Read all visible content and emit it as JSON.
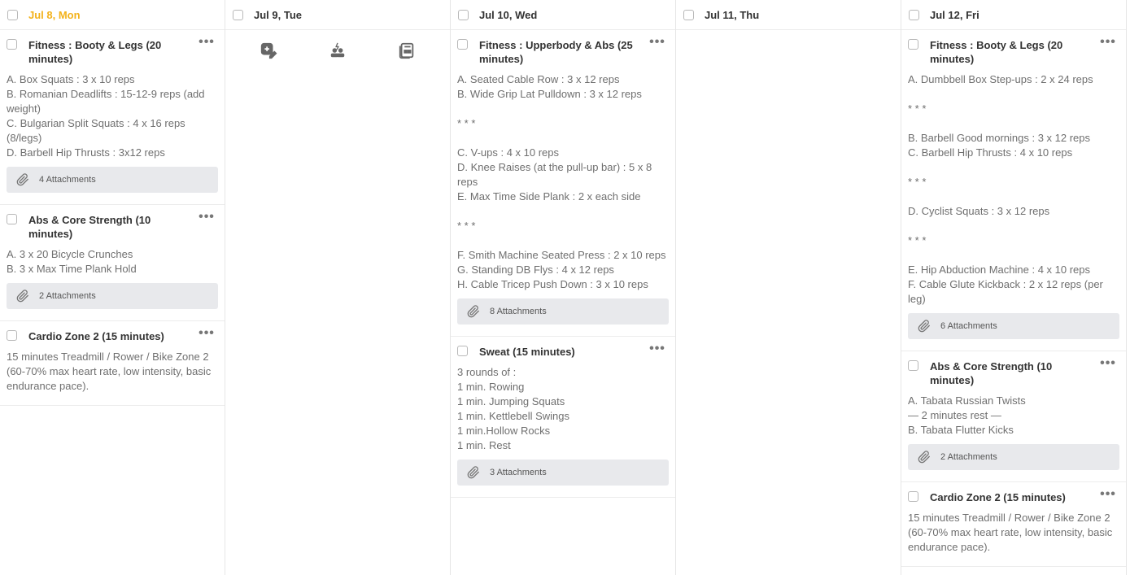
{
  "columns": [
    {
      "title": "Jul 8, Mon",
      "today": true,
      "cards": [
        {
          "title": "Fitness : Booty & Legs (20 minutes)",
          "lines": [
            "A. Box Squats : 3 x 10 reps",
            "B. Romanian Deadlifts : 15-12-9 reps (add weight)",
            "C. Bulgarian Split Squats : 4 x 16 reps (8/legs)",
            "D. Barbell Hip Thrusts : 3x12 reps"
          ],
          "attachments": "4 Attachments"
        },
        {
          "title": "Abs & Core Strength (10 minutes)",
          "lines": [
            "A. 3 x 20 Bicycle Crunches",
            "B. 3 x Max Time Plank Hold"
          ],
          "attachments": "2 Attachments"
        },
        {
          "title": "Cardio Zone 2 (15 minutes)",
          "lines": [
            "15 minutes Treadmill / Rower / Bike Zone 2 (60-70% max heart rate, low intensity, basic endurance pace)."
          ],
          "attachments": null
        }
      ]
    },
    {
      "title": "Jul 9, Tue",
      "today": false,
      "tools": [
        "add-card-icon",
        "template-icon",
        "board-icon"
      ],
      "cards": []
    },
    {
      "title": "Jul 10, Wed",
      "today": false,
      "cards": [
        {
          "title": "Fitness : Upperbody & Abs (25 minutes)",
          "lines": [
            "A. Seated Cable Row : 3 x 12 reps",
            "B. Wide Grip Lat Pulldown : 3 x 12 reps",
            "",
            "* * *",
            "",
            "C. V-ups : 4 x 10 reps",
            "D. Knee Raises (at the pull-up bar) : 5 x 8 reps",
            "E. Max Time Side Plank : 2 x each side",
            "",
            "* * *",
            "",
            "F. Smith Machine Seated Press : 2 x 10 reps",
            "G. Standing DB Flys : 4 x 12 reps",
            "H. Cable Tricep Push Down : 3 x 10 reps"
          ],
          "attachments": "8 Attachments"
        },
        {
          "title": "Sweat (15 minutes)",
          "lines": [
            "3 rounds of :",
            "1 min. Rowing",
            "1 min. Jumping Squats",
            "1 min. Kettlebell Swings",
            "1 min.Hollow Rocks",
            "1 min. Rest"
          ],
          "attachments": "3 Attachments"
        }
      ]
    },
    {
      "title": "Jul 11, Thu",
      "today": false,
      "cards": []
    },
    {
      "title": "Jul 12, Fri",
      "today": false,
      "cards": [
        {
          "title": "Fitness : Booty & Legs (20 minutes)",
          "lines": [
            "A. Dumbbell Box Step-ups : 2 x 24 reps",
            "",
            "* * *",
            "",
            "B. Barbell Good mornings : 3 x 12 reps",
            "C. Barbell Hip Thrusts : 4 x 10 reps",
            "",
            "* * *",
            "",
            "D. Cyclist Squats : 3 x 12 reps",
            "",
            "* * *",
            "",
            "E. Hip Abduction Machine : 4 x 10 reps",
            "F. Cable Glute Kickback : 2 x 12 reps (per leg)"
          ],
          "attachments": "6 Attachments"
        },
        {
          "title": "Abs & Core Strength (10 minutes)",
          "lines": [
            "A. Tabata Russian Twists",
            "— 2 minutes rest —",
            "B. Tabata Flutter Kicks"
          ],
          "attachments": "2 Attachments"
        },
        {
          "title": "Cardio Zone 2 (15 minutes)",
          "lines": [
            "15 minutes Treadmill / Rower / Bike Zone 2 (60-70% max heart rate, low intensity, basic endurance pace)."
          ],
          "attachments": null
        }
      ]
    }
  ],
  "colors": {
    "today": "#f3b21b",
    "text": "#333333",
    "muted": "#6f6f6f",
    "attach_bg": "#e8e9ec"
  }
}
